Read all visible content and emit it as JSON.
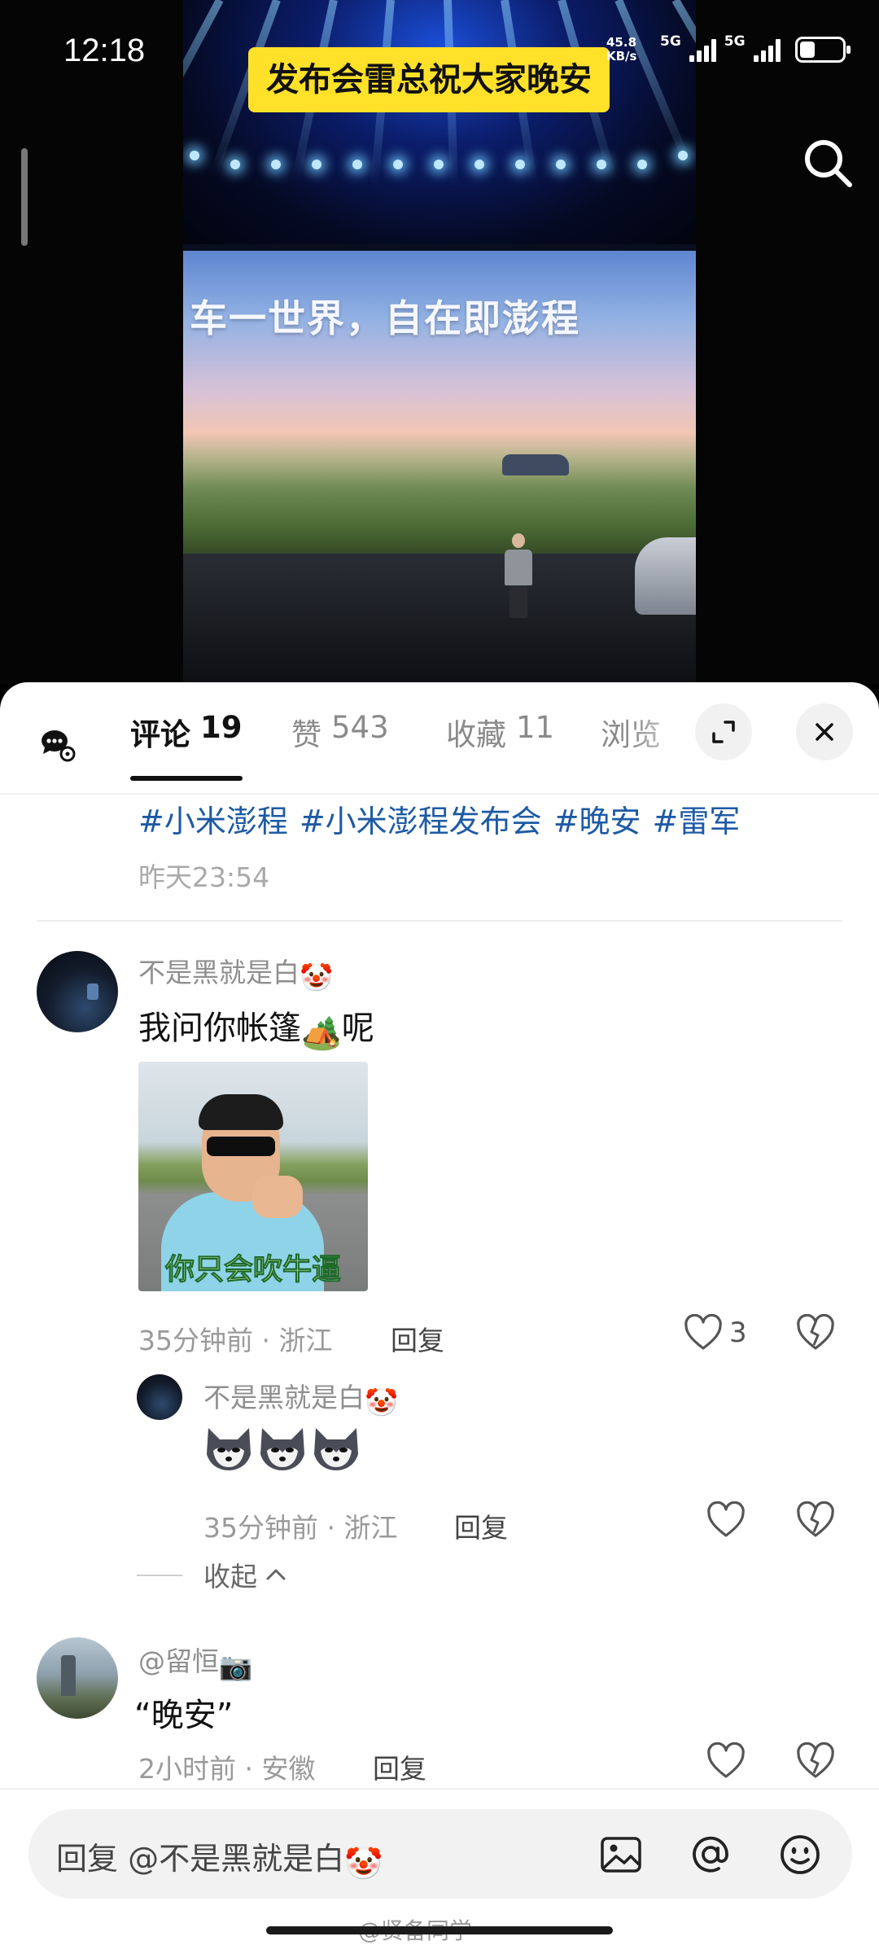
{
  "status_bar": {
    "time": "12:18",
    "net_speed_value": "45.8",
    "net_speed_unit": "KB/s",
    "network_1": "5G",
    "network_2": "5G"
  },
  "video": {
    "title_badge": "发布会雷总祝大家晚安",
    "screen_slogan": "车一世界，自在即澎程"
  },
  "tabs": [
    {
      "label": "评论",
      "count": "19",
      "active": true
    },
    {
      "label": "赞",
      "count": "543",
      "active": false
    },
    {
      "label": "收藏",
      "count": "11",
      "active": false
    },
    {
      "label": "浏览",
      "count": "",
      "active": false
    }
  ],
  "post": {
    "hashtags": [
      "#小米澎程",
      "#小米澎程发布会",
      "#晚安",
      "#雷军"
    ],
    "time": "昨天23:54"
  },
  "comments": [
    {
      "username": "不是黑就是白",
      "username_emoji": "🤡",
      "text_before": "我问你帐篷",
      "text_emoji": "🏕️",
      "text_after": "呢",
      "sticker_caption": "你只会吹牛逼",
      "time_location": "35分钟前 · 浙江",
      "reply_label": "回复",
      "likes": "3"
    },
    {
      "username": "不是黑就是白",
      "username_emoji": "🤡",
      "time_location": "35分钟前 · 浙江",
      "reply_label": "回复",
      "likes": ""
    },
    {
      "username": "@留恒",
      "username_emoji": "📷",
      "text": "“晚安”",
      "time_location": "2小时前 · 安徽",
      "reply_label": "回复",
      "likes": ""
    }
  ],
  "collapse_label": "收起",
  "input": {
    "placeholder": "回复 @不是黑就是白",
    "placeholder_emoji": "🤡"
  },
  "watermark": "@贤备同学",
  "icons": {
    "search": "search-icon",
    "comment_settings": "comment-settings-icon",
    "expand": "expand-icon",
    "close": "close-icon",
    "like": "heart-icon",
    "dislike": "broken-heart-icon",
    "image": "image-icon",
    "mention": "at-icon",
    "emoji": "smiley-icon"
  },
  "colors": {
    "hashtag": "#1d5aa5",
    "title_badge": "#ffe12a",
    "sheet_bg": "#ffffff"
  }
}
